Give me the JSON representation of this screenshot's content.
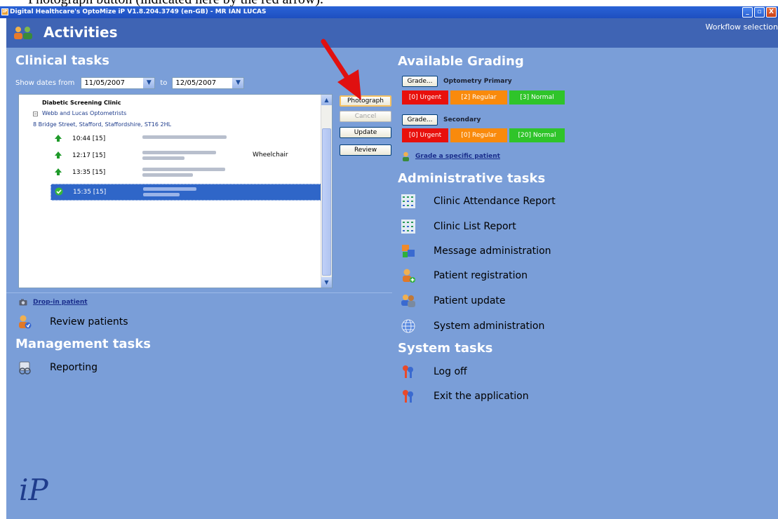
{
  "caption": "Photograph button (indicated here by the red arrow).",
  "window": {
    "title": "Digital Healthcare's OptoMize iP V1.8.204.3749 (en-GB) - MR IAN LUCAS",
    "app_icon": "iP",
    "controls": [
      "_",
      "▫",
      "X"
    ]
  },
  "header": {
    "title": "Activities",
    "workflow_label": "Workflow selection"
  },
  "clinical": {
    "title": "Clinical tasks",
    "show_from_label": "Show dates from",
    "from_date": "11/05/2007",
    "to_label": "to",
    "to_date": "12/05/2007",
    "tree": {
      "clinic": "Diabetic Screening Clinic",
      "practice": "Webb and Lucas Optometrists",
      "address": "8 Bridge Street, Stafford, Staffordshire, ST16 2HL",
      "appointments": [
        {
          "time": "10:44 [15]",
          "note": "",
          "status": "up"
        },
        {
          "time": "12:17 [15]",
          "note": "Wheelchair",
          "status": "up"
        },
        {
          "time": "13:35 [15]",
          "note": "",
          "status": "up"
        },
        {
          "time": "15:35 [15]",
          "note": "",
          "status": "done"
        }
      ]
    },
    "buttons": {
      "photograph": "Photograph",
      "cancel": "Cancel",
      "update": "Update",
      "review": "Review"
    },
    "drop_in": "Drop-in patient",
    "review_patients": "Review patients"
  },
  "management": {
    "title": "Management tasks",
    "reporting": "Reporting"
  },
  "grading": {
    "title": "Available Grading",
    "grade_button": "Grade...",
    "primary_label": "Optometry Primary",
    "secondary_label": "Secondary",
    "primary": {
      "urgent": "[0] Urgent",
      "regular": "[2] Regular",
      "normal": "[3] Normal"
    },
    "secondary": {
      "urgent": "[0] Urgent",
      "regular": "[0] Regular",
      "normal": "[20] Normal"
    },
    "specific_link": "Grade a specific patient",
    "colors": {
      "urgent": "#e8100c",
      "regular": "#f98a0c",
      "normal": "#2fc42a"
    }
  },
  "admin": {
    "title": "Administrative tasks",
    "items": [
      "Clinic Attendance Report",
      "Clinic List Report",
      "Message administration",
      "Patient registration",
      "Patient update",
      "System administration"
    ]
  },
  "system": {
    "title": "System tasks",
    "items": [
      "Log off",
      "Exit the application"
    ]
  },
  "logo": "iP",
  "annotation": {
    "arrow_color": "#e01010"
  }
}
